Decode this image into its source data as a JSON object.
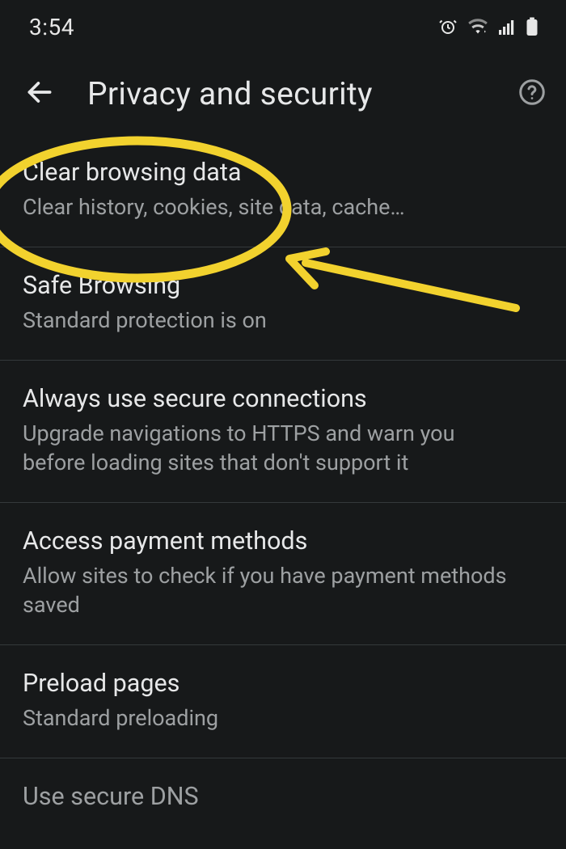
{
  "statusbar": {
    "time": "3:54",
    "icons": {
      "alarm": "alarm-icon",
      "wifi": "wifi-icon",
      "signal": "signal-icon",
      "battery": "battery-icon"
    }
  },
  "appbar": {
    "title": "Privacy and security",
    "back_icon": "arrow-back-icon",
    "help_icon": "help-outline-icon"
  },
  "settings": [
    {
      "title": "Clear browsing data",
      "subtitle": "Clear history, cookies, site data, cache…"
    },
    {
      "title": "Safe Browsing",
      "subtitle": "Standard protection is on"
    },
    {
      "title": "Always use secure connections",
      "subtitle": "Upgrade navigations to HTTPS and warn you before loading sites that don't support it"
    },
    {
      "title": "Access payment methods",
      "subtitle": "Allow sites to check if you have payment methods saved"
    },
    {
      "title": "Preload pages",
      "subtitle": "Standard preloading"
    },
    {
      "title": "Use secure DNS",
      "subtitle": ""
    }
  ],
  "annotation": {
    "type": "highlight-ellipse-arrow",
    "target_index": 0,
    "color": "#f2d22e"
  }
}
